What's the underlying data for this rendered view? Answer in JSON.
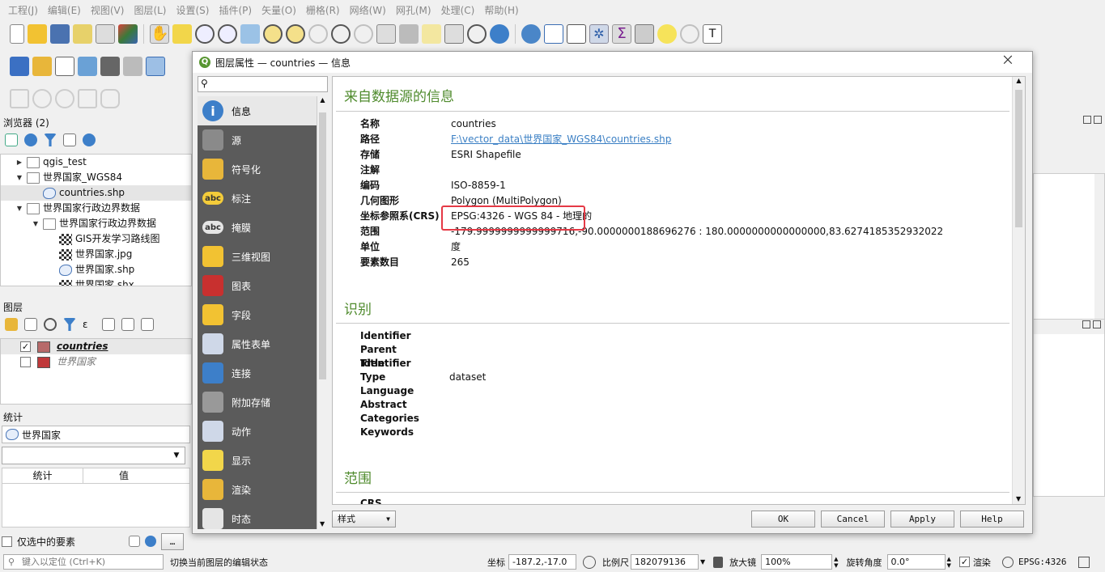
{
  "menu": [
    "工程(J)",
    "编辑(E)",
    "视图(V)",
    "图层(L)",
    "设置(S)",
    "插件(P)",
    "矢量(O)",
    "栅格(R)",
    "网络(W)",
    "网孔(M)",
    "处理(C)",
    "帮助(H)"
  ],
  "browser": {
    "title": "浏览器 (2)",
    "items": [
      {
        "label": "qgis_test",
        "level": 1,
        "icon": "folder"
      },
      {
        "label": "世界国家_WGS84",
        "level": 1,
        "icon": "folder",
        "expanded": true
      },
      {
        "label": "countries.shp",
        "level": 2,
        "icon": "shp"
      },
      {
        "label": "世界国家行政边界数据",
        "level": 1,
        "icon": "folder",
        "expanded": true
      },
      {
        "label": "世界国家行政边界数据",
        "level": 2,
        "icon": "folder",
        "expanded": true
      },
      {
        "label": "GIS开发学习路线图",
        "level": 3,
        "icon": "raster"
      },
      {
        "label": "世界国家.jpg",
        "level": 3,
        "icon": "raster"
      },
      {
        "label": "世界国家.shp",
        "level": 3,
        "icon": "shp"
      },
      {
        "label": "世界国家.shx",
        "level": 3,
        "icon": "raster"
      }
    ]
  },
  "layers": {
    "title": "图层",
    "items": [
      {
        "name": "countries",
        "checked": true,
        "color": "#b76a6a"
      },
      {
        "name": "世界国家",
        "checked": false,
        "color": "#c0393b"
      }
    ]
  },
  "stats": {
    "title": "统计",
    "layer": "世界国家",
    "col_stat": "统计",
    "col_value": "值",
    "selected_only": "仅选中的要素",
    "more": "…"
  },
  "dialog": {
    "title": "图层属性 — countries — 信息",
    "close": "⨉",
    "nav": [
      {
        "label": "信息",
        "icon": "info-icon",
        "sel": true
      },
      {
        "label": "源",
        "icon": "source-icon"
      },
      {
        "label": "符号化",
        "icon": "symbology-icon"
      },
      {
        "label": "标注",
        "icon": "labels-icon",
        "txt": "abc"
      },
      {
        "label": "掩膜",
        "icon": "mask-icon",
        "txt": "abc"
      },
      {
        "label": "三维视图",
        "icon": "3d-view-icon"
      },
      {
        "label": "图表",
        "icon": "diagram-icon"
      },
      {
        "label": "字段",
        "icon": "fields-icon"
      },
      {
        "label": "属性表单",
        "icon": "attribute-form-icon"
      },
      {
        "label": "连接",
        "icon": "joins-icon"
      },
      {
        "label": "附加存储",
        "icon": "auxiliary-storage-icon"
      },
      {
        "label": "动作",
        "icon": "actions-icon"
      },
      {
        "label": "显示",
        "icon": "display-icon"
      },
      {
        "label": "渲染",
        "icon": "rendering-icon"
      },
      {
        "label": "时态",
        "icon": "temporal-icon"
      }
    ],
    "section1": "来自数据源的信息",
    "info": [
      {
        "k": "名称",
        "v": "countries"
      },
      {
        "k": "路径",
        "v": "F:\\vector_data\\世界国家_WGS84\\countries.shp",
        "link": true
      },
      {
        "k": "存储",
        "v": "ESRI Shapefile"
      },
      {
        "k": "注解",
        "v": ""
      },
      {
        "k": "编码",
        "v": "ISO-8859-1"
      },
      {
        "k": "几何图形",
        "v": "Polygon (MultiPolygon)"
      },
      {
        "k": "坐标参照系(CRS)",
        "v": "EPSG:4326 - WGS 84 - 地理的",
        "highlight": true
      },
      {
        "k": "范围",
        "v": "-179.9999999999999716,-90.0000000188696276 : 180.0000000000000000,83.6274185352932022"
      },
      {
        "k": "单位",
        "v": "度"
      },
      {
        "k": "要素数目",
        "v": "265"
      }
    ],
    "section2": "识别",
    "ident": [
      {
        "k": "Identifier",
        "v": ""
      },
      {
        "k": "Parent Identifier",
        "v": ""
      },
      {
        "k": "Title",
        "v": ""
      },
      {
        "k": "Type",
        "v": "dataset"
      },
      {
        "k": "Language",
        "v": ""
      },
      {
        "k": "Abstract",
        "v": ""
      },
      {
        "k": "Categories",
        "v": ""
      },
      {
        "k": "Keywords",
        "v": ""
      }
    ],
    "section3": "范围",
    "crs_partial": "CRS",
    "style_btn": "样式",
    "ok": "OK",
    "cancel": "Cancel",
    "apply": "Apply",
    "help": "Help"
  },
  "statusbar": {
    "locate_placeholder": "键入以定位 (Ctrl+K)",
    "hint": "切换当前图层的编辑状态",
    "coord_label": "坐标",
    "coord": "-187.2,-17.0",
    "scale_label": "比例尺",
    "scale": "182079136",
    "magnifier_label": "放大镜",
    "magnifier": "100%",
    "rotation_label": "旋转角度",
    "rotation": "0.0°",
    "render": "渲染",
    "epsg": "EPSG:4326"
  },
  "colors": {
    "accent": "#4f8b2d",
    "highlight_box": "#e53945",
    "nav_bg": "#5b5b5b"
  }
}
